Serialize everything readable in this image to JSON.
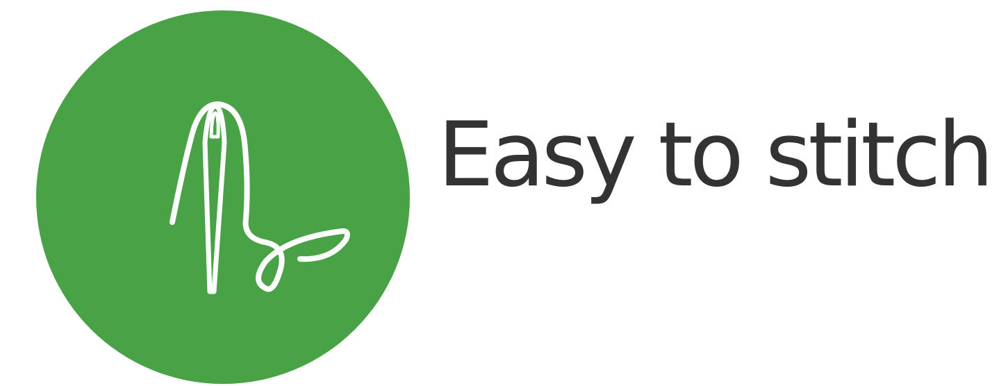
{
  "feature": {
    "title": "Easy to stitch",
    "icon": "needle-and-thread-icon",
    "circle_color": "#4aa247",
    "icon_color": "#ffffff",
    "text_color": "#333333"
  }
}
